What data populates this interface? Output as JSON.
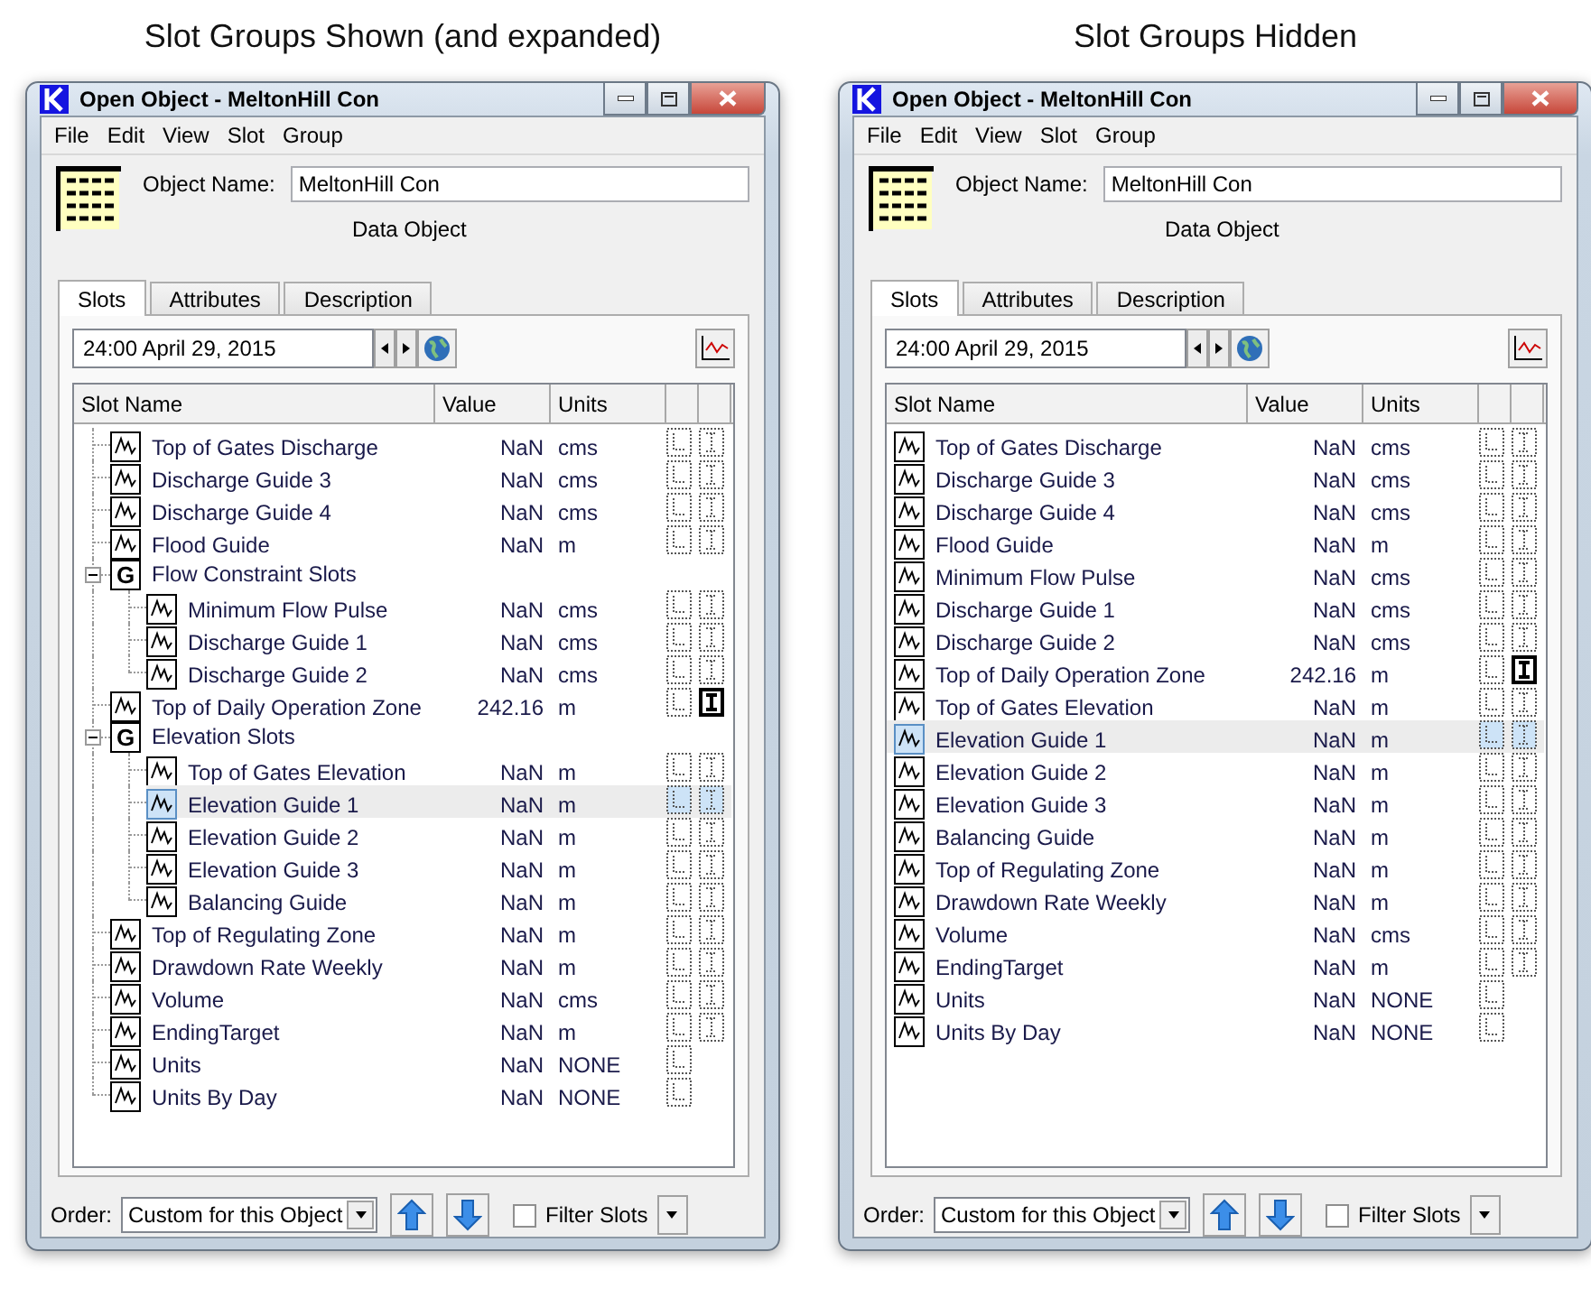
{
  "panels": [
    {
      "caption": "Slot Groups Shown (and expanded)",
      "window": {
        "title": "Open Object - MeltonHill Con",
        "menu": [
          "File",
          "Edit",
          "View",
          "Slot",
          "Group"
        ],
        "object_name_label": "Object Name:",
        "object_name": "MeltonHill Con",
        "object_type": "Data Object",
        "tabs": [
          {
            "label": "Slots",
            "selected": true
          },
          {
            "label": "Attributes",
            "selected": false
          },
          {
            "label": "Description",
            "selected": false
          }
        ],
        "date": "24:00 April 29, 2015",
        "columns": [
          "Slot Name",
          "Value",
          "Units"
        ],
        "slots": [
          {
            "kind": "slot",
            "name": "Top of Gates Discharge",
            "value": "NaN",
            "units": "cms",
            "i_flag": true,
            "i_active": false,
            "selected": false
          },
          {
            "kind": "slot",
            "name": "Discharge Guide 3",
            "value": "NaN",
            "units": "cms",
            "i_flag": true,
            "i_active": false,
            "selected": false
          },
          {
            "kind": "slot",
            "name": "Discharge Guide 4",
            "value": "NaN",
            "units": "cms",
            "i_flag": true,
            "i_active": false,
            "selected": false
          },
          {
            "kind": "slot",
            "name": "Flood Guide",
            "value": "NaN",
            "units": "m",
            "i_flag": true,
            "i_active": false,
            "selected": false
          },
          {
            "kind": "group",
            "icon_text": "G",
            "name": "Flow Constraint Slots",
            "expanded": true,
            "selected": false,
            "children": [
              {
                "kind": "slot",
                "name": "Minimum Flow Pulse",
                "value": "NaN",
                "units": "cms",
                "i_flag": true,
                "i_active": false,
                "selected": false
              },
              {
                "kind": "slot",
                "name": "Discharge Guide 1",
                "value": "NaN",
                "units": "cms",
                "i_flag": true,
                "i_active": false,
                "selected": false
              },
              {
                "kind": "slot",
                "name": "Discharge Guide 2",
                "value": "NaN",
                "units": "cms",
                "i_flag": true,
                "i_active": false,
                "selected": false
              }
            ]
          },
          {
            "kind": "slot",
            "name": "Top of Daily Operation Zone",
            "value": "242.16",
            "units": "m",
            "i_flag": true,
            "i_active": true,
            "selected": false
          },
          {
            "kind": "group",
            "icon_text": "G",
            "name": "Elevation Slots",
            "expanded": true,
            "selected": false,
            "children": [
              {
                "kind": "slot",
                "name": "Top of Gates Elevation",
                "value": "NaN",
                "units": "m",
                "i_flag": true,
                "i_active": false,
                "selected": false
              },
              {
                "kind": "slot",
                "name": "Elevation Guide 1",
                "value": "NaN",
                "units": "m",
                "i_flag": true,
                "i_active": false,
                "selected": true
              },
              {
                "kind": "slot",
                "name": "Elevation Guide 2",
                "value": "NaN",
                "units": "m",
                "i_flag": true,
                "i_active": false,
                "selected": false
              },
              {
                "kind": "slot",
                "name": "Elevation Guide 3",
                "value": "NaN",
                "units": "m",
                "i_flag": true,
                "i_active": false,
                "selected": false
              },
              {
                "kind": "slot",
                "name": "Balancing Guide",
                "value": "NaN",
                "units": "m",
                "i_flag": true,
                "i_active": false,
                "selected": false
              }
            ]
          },
          {
            "kind": "slot",
            "name": "Top of Regulating Zone",
            "value": "NaN",
            "units": "m",
            "i_flag": true,
            "i_active": false,
            "selected": false
          },
          {
            "kind": "slot",
            "name": "Drawdown Rate Weekly",
            "value": "NaN",
            "units": "m",
            "i_flag": true,
            "i_active": false,
            "selected": false
          },
          {
            "kind": "slot",
            "name": "Volume",
            "value": "NaN",
            "units": "cms",
            "i_flag": true,
            "i_active": false,
            "selected": false
          },
          {
            "kind": "slot",
            "name": "EndingTarget",
            "value": "NaN",
            "units": "m",
            "i_flag": true,
            "i_active": false,
            "selected": false
          },
          {
            "kind": "slot",
            "name": "Units",
            "value": "NaN",
            "units": "NONE",
            "i_flag": false,
            "selected": false
          },
          {
            "kind": "slot",
            "name": "Units By Day",
            "value": "NaN",
            "units": "NONE",
            "i_flag": false,
            "selected": false
          }
        ],
        "order_label": "Order:",
        "order_value": "Custom for this Object",
        "filter": {
          "label": "Filter Slots",
          "checked": false
        }
      }
    },
    {
      "caption": "Slot Groups Hidden",
      "window": {
        "title": "Open Object - MeltonHill Con",
        "menu": [
          "File",
          "Edit",
          "View",
          "Slot",
          "Group"
        ],
        "object_name_label": "Object Name:",
        "object_name": "MeltonHill Con",
        "object_type": "Data Object",
        "tabs": [
          {
            "label": "Slots",
            "selected": true
          },
          {
            "label": "Attributes",
            "selected": false
          },
          {
            "label": "Description",
            "selected": false
          }
        ],
        "date": "24:00 April 29, 2015",
        "columns": [
          "Slot Name",
          "Value",
          "Units"
        ],
        "slots": [
          {
            "kind": "slot",
            "name": "Top of Gates Discharge",
            "value": "NaN",
            "units": "cms",
            "i_flag": true,
            "i_active": false,
            "selected": false
          },
          {
            "kind": "slot",
            "name": "Discharge Guide 3",
            "value": "NaN",
            "units": "cms",
            "i_flag": true,
            "i_active": false,
            "selected": false
          },
          {
            "kind": "slot",
            "name": "Discharge Guide 4",
            "value": "NaN",
            "units": "cms",
            "i_flag": true,
            "i_active": false,
            "selected": false
          },
          {
            "kind": "slot",
            "name": "Flood Guide",
            "value": "NaN",
            "units": "m",
            "i_flag": true,
            "i_active": false,
            "selected": false
          },
          {
            "kind": "slot",
            "name": "Minimum Flow Pulse",
            "value": "NaN",
            "units": "cms",
            "i_flag": true,
            "i_active": false,
            "selected": false
          },
          {
            "kind": "slot",
            "name": "Discharge Guide 1",
            "value": "NaN",
            "units": "cms",
            "i_flag": true,
            "i_active": false,
            "selected": false
          },
          {
            "kind": "slot",
            "name": "Discharge Guide 2",
            "value": "NaN",
            "units": "cms",
            "i_flag": true,
            "i_active": false,
            "selected": false
          },
          {
            "kind": "slot",
            "name": "Top of Daily Operation Zone",
            "value": "242.16",
            "units": "m",
            "i_flag": true,
            "i_active": true,
            "selected": false
          },
          {
            "kind": "slot",
            "name": "Top of Gates Elevation",
            "value": "NaN",
            "units": "m",
            "i_flag": true,
            "i_active": false,
            "selected": false
          },
          {
            "kind": "slot",
            "name": "Elevation Guide 1",
            "value": "NaN",
            "units": "m",
            "i_flag": true,
            "i_active": false,
            "selected": true
          },
          {
            "kind": "slot",
            "name": "Elevation Guide 2",
            "value": "NaN",
            "units": "m",
            "i_flag": true,
            "i_active": false,
            "selected": false
          },
          {
            "kind": "slot",
            "name": "Elevation Guide 3",
            "value": "NaN",
            "units": "m",
            "i_flag": true,
            "i_active": false,
            "selected": false
          },
          {
            "kind": "slot",
            "name": "Balancing Guide",
            "value": "NaN",
            "units": "m",
            "i_flag": true,
            "i_active": false,
            "selected": false
          },
          {
            "kind": "slot",
            "name": "Top of Regulating Zone",
            "value": "NaN",
            "units": "m",
            "i_flag": true,
            "i_active": false,
            "selected": false
          },
          {
            "kind": "slot",
            "name": "Drawdown Rate Weekly",
            "value": "NaN",
            "units": "m",
            "i_flag": true,
            "i_active": false,
            "selected": false
          },
          {
            "kind": "slot",
            "name": "Volume",
            "value": "NaN",
            "units": "cms",
            "i_flag": true,
            "i_active": false,
            "selected": false
          },
          {
            "kind": "slot",
            "name": "EndingTarget",
            "value": "NaN",
            "units": "m",
            "i_flag": true,
            "i_active": false,
            "selected": false
          },
          {
            "kind": "slot",
            "name": "Units",
            "value": "NaN",
            "units": "NONE",
            "i_flag": false,
            "selected": false
          },
          {
            "kind": "slot",
            "name": "Units By Day",
            "value": "NaN",
            "units": "NONE",
            "i_flag": false,
            "selected": false
          }
        ],
        "order_label": "Order:",
        "order_value": "Custom for this Object",
        "filter": {
          "label": "Filter Slots",
          "checked": false
        }
      }
    }
  ]
}
